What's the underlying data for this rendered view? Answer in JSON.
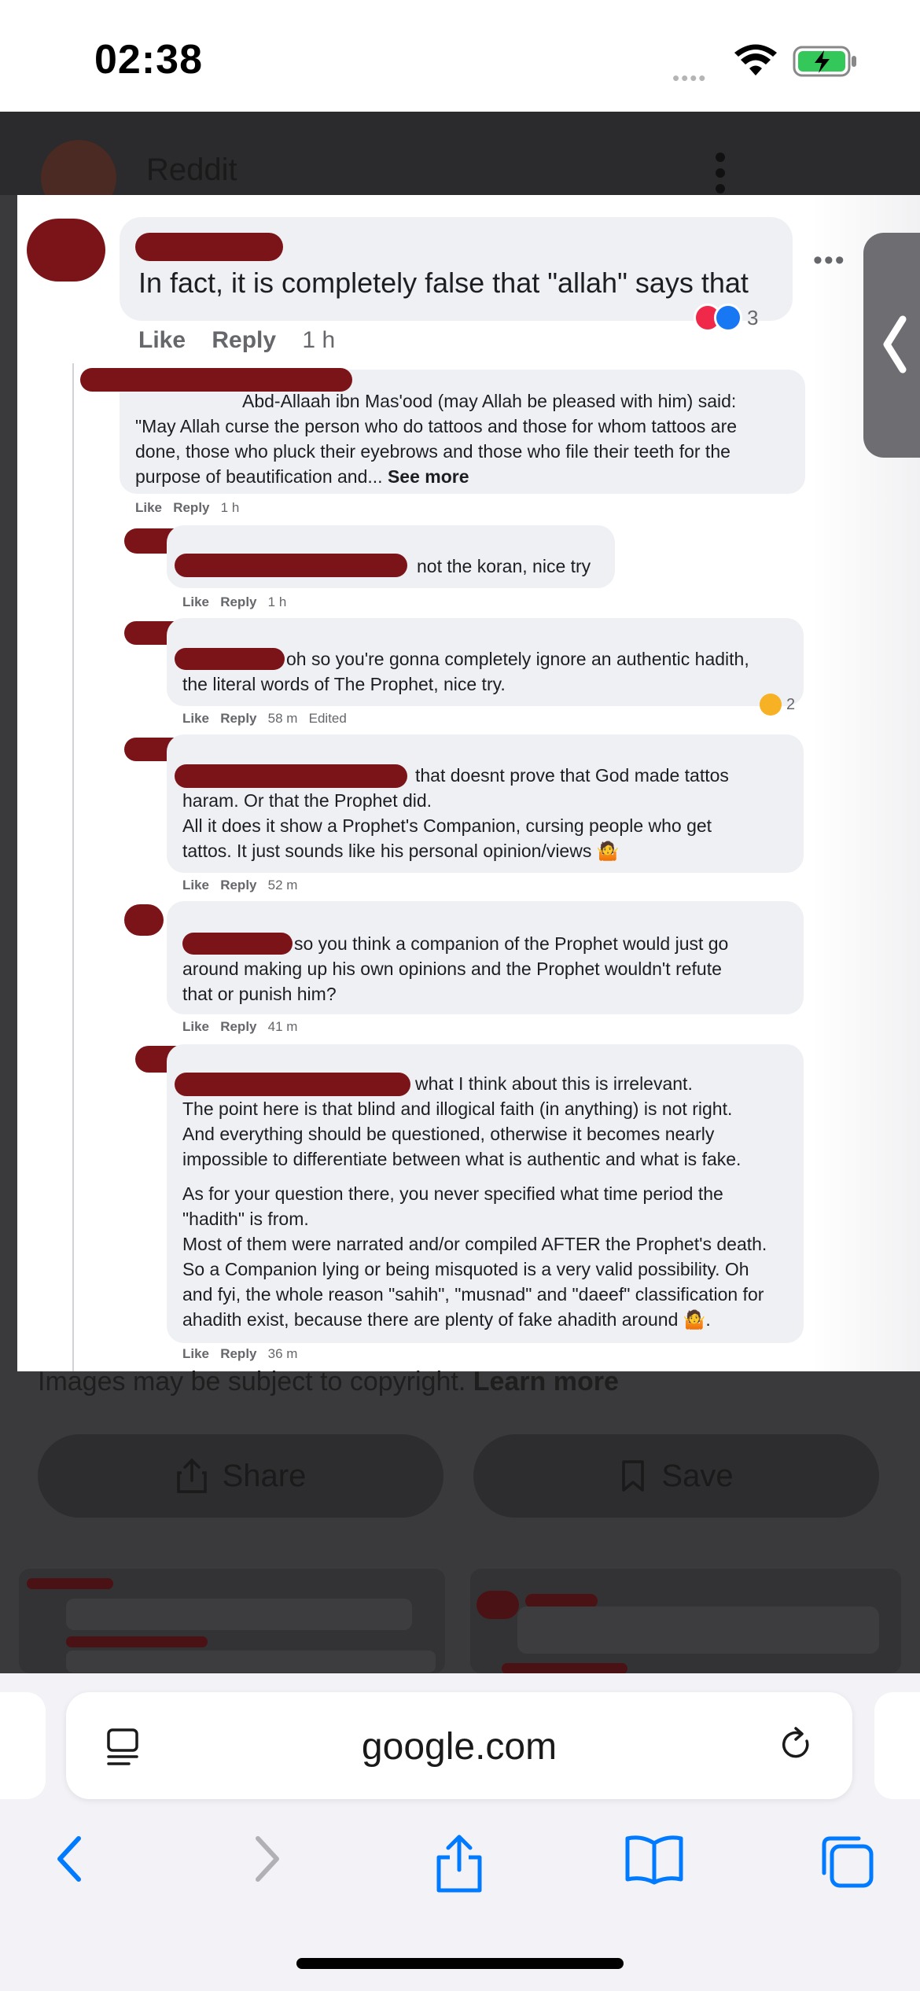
{
  "status_bar": {
    "time": "02:38"
  },
  "background_page": {
    "title": "Reddit",
    "caption_text": "Images may be subject to copyright.",
    "caption_link": "Learn more",
    "share_label": "Share",
    "save_label": "Save"
  },
  "screenshot": {
    "first_comment": {
      "text": "In fact, it is completely false that \"allah\" says that",
      "like": "Like",
      "reply": "Reply",
      "time": "1 h",
      "reaction_count": "3"
    },
    "comments": [
      {
        "lines": [
          "Abd-Allaah ibn Mas'ood (may Allah be pleased with him) said:",
          "\"May Allah curse the person who do tattoos and those for whom tattoos are",
          "done, those who pluck their eyebrows and those who file their teeth for the",
          "purpose of beautification and..."
        ],
        "see_more": "See more",
        "like": "Like",
        "reply": "Reply",
        "time": "1 h"
      },
      {
        "lines": [
          "not the koran, nice try"
        ],
        "like": "Like",
        "reply": "Reply",
        "time": "1 h"
      },
      {
        "lines": [
          "oh so you're gonna completely ignore an authentic hadith,",
          "the literal words of The Prophet, nice try."
        ],
        "like": "Like",
        "reply": "Reply",
        "time": "58 m",
        "edited": "Edited",
        "reaction_count": "2"
      },
      {
        "lines": [
          "that doesnt prove that God made tattos",
          "haram. Or that the Prophet did.",
          "All it does it show a Prophet's Companion, cursing people who get",
          "tattos. It just sounds like his personal opinion/views 🤷"
        ],
        "like": "Like",
        "reply": "Reply",
        "time": "52 m"
      },
      {
        "lines": [
          "so you think a companion of the Prophet would just go",
          "around making up his own opinions and the Prophet wouldn't refute",
          "that or punish him?"
        ],
        "like": "Like",
        "reply": "Reply",
        "time": "41 m"
      },
      {
        "lines": [
          "what I think about this is irrelevant.",
          "The point here is that blind and illogical faith (in anything) is not right.",
          "And everything should be questioned, otherwise it becomes nearly",
          "impossible to differentiate between what is authentic and what is fake.",
          "As for your question there, you never specified what time period the",
          "\"hadith\" is from.",
          "Most of them were narrated and/or compiled AFTER the Prophet's death.",
          "So a Companion lying or being misquoted is a very valid possibility. Oh",
          "and fyi, the whole reason \"sahih\", \"musnad\" and \"daeef\" classification for",
          "ahadith exist, because there are plenty of fake ahadith around 🤷."
        ],
        "like": "Like",
        "reply": "Reply",
        "time": "36 m"
      }
    ]
  },
  "browser": {
    "url": "google.com"
  },
  "icons": {
    "wifi": "wifi-icon",
    "battery": "battery-charging-icon",
    "kebab": "more-vertical-icon",
    "side_tab": "chevron-left-icon",
    "share": "share-icon",
    "save": "bookmark-icon",
    "reader": "reader-icon",
    "reload": "reload-icon",
    "back": "chevron-left-icon",
    "forward": "chevron-right-icon",
    "share_nav": "share-icon",
    "bookmarks": "book-icon",
    "tabs": "tabs-icon"
  },
  "colors": {
    "redaction": "#7b1418",
    "link_blue": "#007aff",
    "battery_green": "#34c759"
  }
}
